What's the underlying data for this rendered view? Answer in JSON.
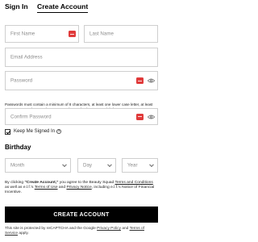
{
  "tabs": {
    "sign_in": "Sign In",
    "create_account": "Create Account"
  },
  "form": {
    "first_name_placeholder": "First Name",
    "last_name_placeholder": "Last Name",
    "email_placeholder": "Email Address",
    "password_placeholder": "Password",
    "password_hint": "Passwords must contain a minimum of 8 characters, at least one lower case letter, at least one upper case letter, at least one number and at least 1 special character.",
    "confirm_password_placeholder": "Confirm Password",
    "keep_signed_in_label": "Keep Me Signed In",
    "keep_signed_in_checked": true,
    "info_symbol": "?"
  },
  "birthday": {
    "heading": "Birthday",
    "month_placeholder": "Month",
    "day_placeholder": "Day",
    "year_placeholder": "Year"
  },
  "legal": {
    "prefix": "By clicking ",
    "cta_quote": "\"Create Account,\"",
    "middle": " you agree to the Beauty Squad ",
    "terms_link": "Terms and Conditions",
    "as_well_as": " as well as e.l.f.'s ",
    "terms_use_link": "Terms of Use",
    "and": " and ",
    "privacy_link": "Privacy Notice",
    "suffix": ", including e.l.f.'s Notice of Financial Incentive."
  },
  "submit_label": "CREATE ACCOUNT",
  "recaptcha": {
    "prefix": "This site is protected by reCAPTCHA and the Google ",
    "privacy_link": "Privacy Policy",
    "and": " and ",
    "terms_link": "Terms of Service",
    "suffix": " apply."
  },
  "colors": {
    "accent": "#000000",
    "badge": "#e03a3a",
    "border": "#cfcfcf",
    "placeholder": "#8d8d8d"
  },
  "icons": {
    "badge": "password-manager-icon",
    "eye": "eye-icon",
    "chevron": "chevron-down-icon",
    "check": "checkmark-icon",
    "info": "info-icon"
  }
}
